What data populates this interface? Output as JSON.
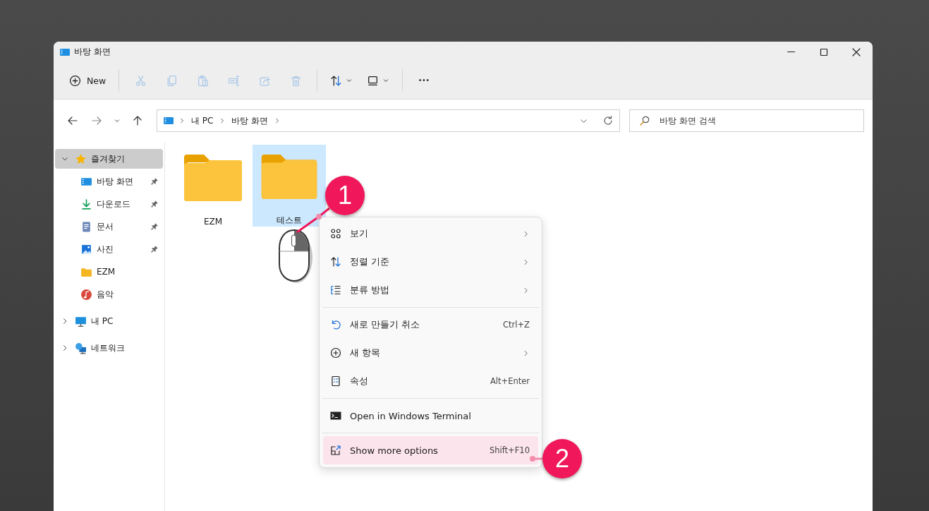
{
  "window": {
    "title": "바탕 화면"
  },
  "toolbar": {
    "new_label": "New",
    "actions": [
      {
        "kind": "cut",
        "disabled": true
      },
      {
        "kind": "copy",
        "disabled": true
      },
      {
        "kind": "paste",
        "disabled": true
      },
      {
        "kind": "rename",
        "disabled": true
      },
      {
        "kind": "share",
        "disabled": true
      },
      {
        "kind": "delete",
        "disabled": true
      },
      {
        "kind": "sort",
        "disabled": false
      },
      {
        "kind": "view",
        "disabled": false
      },
      {
        "kind": "more",
        "disabled": false
      }
    ]
  },
  "address": {
    "crumbs": [
      "내 PC",
      "바탕 화면"
    ]
  },
  "search": {
    "placeholder": "바탕 화면 검색"
  },
  "sidebar": {
    "items": [
      {
        "label": "즐겨찾기",
        "expanded": true,
        "selected": true,
        "children": [
          {
            "label": "바탕 화면",
            "pinned": true,
            "selected": false
          },
          {
            "label": "다운로드",
            "pinned": true,
            "selected": false
          },
          {
            "label": "문서",
            "pinned": true,
            "selected": false
          },
          {
            "label": "사진",
            "pinned": true,
            "selected": false
          },
          {
            "label": "EZM",
            "pinned": false,
            "selected": false
          },
          {
            "label": "음악",
            "pinned": false,
            "selected": false
          }
        ]
      },
      {
        "label": "내 PC",
        "expanded": false,
        "selected": false
      },
      {
        "label": "네트워크",
        "expanded": false,
        "selected": false
      }
    ]
  },
  "files": [
    {
      "name": "EZM",
      "selected": false
    },
    {
      "name": "테스트",
      "selected": true
    }
  ],
  "context_menu": {
    "items": [
      {
        "kind": "item",
        "label": "보기",
        "submenu": true,
        "selected": false
      },
      {
        "kind": "item",
        "label": "정렬 기준",
        "submenu": true,
        "selected": false
      },
      {
        "kind": "item",
        "label": "분류 방법",
        "submenu": true,
        "selected": false
      },
      {
        "kind": "separator"
      },
      {
        "kind": "item",
        "label": "새로 만들기 취소",
        "shortcut": "Ctrl+Z",
        "submenu": false,
        "selected": false
      },
      {
        "kind": "item",
        "label": "새 항목",
        "submenu": true,
        "selected": false
      },
      {
        "kind": "item",
        "label": "속성",
        "shortcut": "Alt+Enter",
        "submenu": false,
        "selected": false
      },
      {
        "kind": "separator"
      },
      {
        "kind": "item",
        "label": "Open in Windows Terminal",
        "submenu": false,
        "selected": false
      },
      {
        "kind": "separator"
      },
      {
        "kind": "item",
        "label": "Show more options",
        "shortcut": "Shift+F10",
        "submenu": false,
        "selected": true
      }
    ]
  },
  "callouts": [
    "1",
    "2"
  ]
}
